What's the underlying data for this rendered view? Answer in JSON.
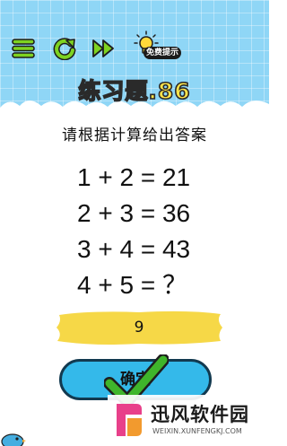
{
  "header": {
    "title": "练习题.86",
    "hint_label": "免费提示",
    "menu_icon": "hamburger-menu-icon",
    "restart_icon": "restart-icon",
    "skip_icon": "fast-forward-icon",
    "hint_icon": "lightbulb-icon"
  },
  "puzzle": {
    "instruction": "请根据计算给出答案",
    "equations": [
      "1 + 2 = 21",
      "2 + 3 = 36",
      "3 + 4 = 43",
      "4 + 5 = ？"
    ]
  },
  "answer": {
    "value": "9"
  },
  "confirm_label": "确定",
  "watermark": {
    "name": "迅风软件园",
    "url": "WEIXIN.XUNFENGKJ.COM"
  },
  "colors": {
    "sky": "#8fd6f6",
    "title_yellow": "#ffe34a",
    "button_green": "#7ed321",
    "answer_yellow": "#f6d847",
    "confirm_blue": "#34b9ea",
    "check_green": "#3fb52b"
  }
}
